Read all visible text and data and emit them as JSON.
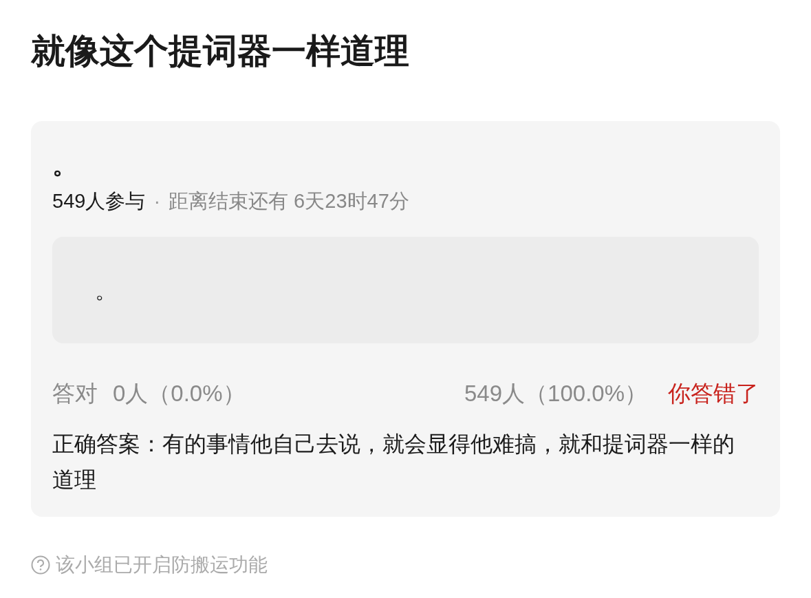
{
  "title": "就像这个提词器一样道理",
  "quiz": {
    "question": "。",
    "participants": "549人参与",
    "separator": "·",
    "deadline": "距离结束还有 6天23时47分",
    "options": [
      {
        "text": "。"
      }
    ],
    "stats": {
      "correct_label": "答对",
      "correct_count": "0人（0.0%）",
      "wrong_count": "549人（100.0%）",
      "result": "你答错了"
    },
    "answer": "正确答案：有的事情他自己去说，就会显得他难搞，就和提词器一样的道理"
  },
  "footer_note": "该小组已开启防搬运功能"
}
